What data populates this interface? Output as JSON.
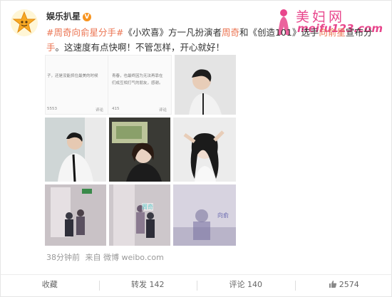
{
  "user": {
    "name": "娱乐扒星",
    "verified_badge": "V",
    "avatar_icon": "star-avatar"
  },
  "watermark": {
    "title": "美妇网",
    "url": "meifu123.com"
  },
  "post": {
    "hashtag": "#周奇向俞星分手#",
    "text_a": "《小欢喜》方一凡扮演者",
    "mention_a": "周奇",
    "text_b": "和《创造101》选手",
    "mention_b": "向俞星",
    "text_c": "宣布分",
    "text_c2": "手",
    "text_d": "。这速度有点快啊！不管怎样，开心就好！"
  },
  "screenshot_tile": {
    "left_snip": "子，还是没能抓住最美的时候",
    "right_snip_1": "青春，也最终因为无法再靠在",
    "right_snip_2": "们成互相打气的朋友，感谢。",
    "left_stat_1": "5553",
    "left_stat_2": "评论",
    "right_stat_1": "415",
    "right_stat_2": "评论"
  },
  "photo_captions": {
    "cctv_1": "周奇",
    "cctv_2": "向俞"
  },
  "meta": {
    "time": "38分钟前",
    "source": "来自 微博 weibo.com"
  },
  "actions": {
    "collect": "收藏",
    "forward": "转发 142",
    "comment": "评论 140",
    "like": "2574"
  },
  "colors": {
    "link": "#eb7350",
    "watermark": "#e8468c",
    "badge": "#f7931e"
  }
}
